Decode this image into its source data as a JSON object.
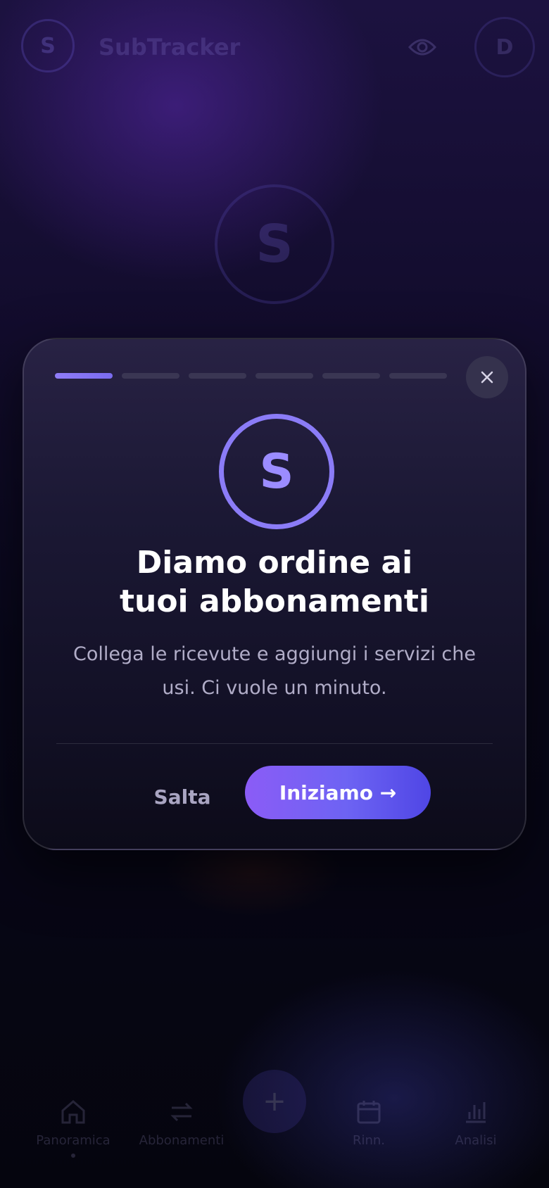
{
  "header": {
    "logo_letter": "S",
    "app_title": "SubTracker",
    "avatar_letter": "D"
  },
  "background": {
    "logo_letter": "S"
  },
  "bottom_nav": {
    "items": [
      {
        "label": "Panoramica",
        "icon": "home-icon"
      },
      {
        "label": "Abbonamenti",
        "icon": "swap-icon"
      },
      {
        "label": "+",
        "icon": "plus-icon"
      },
      {
        "label": "Rinn.",
        "icon": "calendar-icon"
      },
      {
        "label": "Analisi",
        "icon": "chart-icon"
      }
    ]
  },
  "dialog": {
    "steps_total": 6,
    "step_current": 1,
    "logo_letter": "S",
    "title_line1": "Diamo ordine ai",
    "title_line2": "tuoi abbonamenti",
    "description": "Collega le ricevute e aggiungi i servizi che usi. Ci vuole un minuto.",
    "skip_label": "Salta",
    "start_label": "Iniziamo →",
    "close_icon": "close-icon"
  },
  "colors": {
    "accent": "#8b7cf7",
    "button_start": "#8b5cf6",
    "button_end": "#4f46e5"
  }
}
